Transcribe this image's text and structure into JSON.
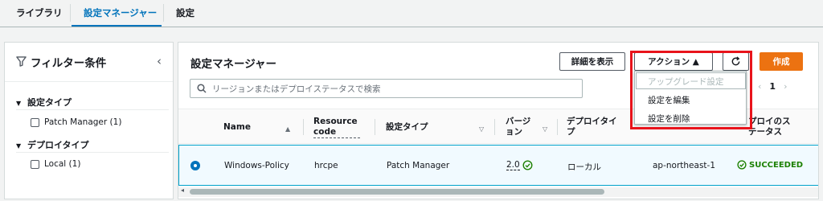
{
  "tabs": [
    {
      "label": "ライブラリ"
    },
    {
      "label": "設定マネージャー"
    },
    {
      "label": "設定"
    }
  ],
  "filter_panel": {
    "title": "フィルター条件",
    "groups": [
      {
        "label": "設定タイプ",
        "options": [
          {
            "label": "Patch Manager (1)"
          }
        ]
      },
      {
        "label": "デプロイタイプ",
        "options": [
          {
            "label": "Local (1)"
          }
        ]
      }
    ]
  },
  "main": {
    "title": "設定マネージャー",
    "details_button": "詳細を表示",
    "actions_button": "アクション ▲",
    "create_button": "作成",
    "search_placeholder": "リージョンまたはデプロイステータスで検索",
    "pager": {
      "current_page": "1"
    },
    "columns": {
      "name": "Name",
      "resource_code_1": "Resource",
      "resource_code_2": "code",
      "type": "設定タイプ",
      "version_1": "バージ",
      "version_2": "ョン",
      "deploy_type_1": "デプロイタイ",
      "deploy_type_2": "プ",
      "status_1": "プロイのス",
      "status_2": "テータス"
    },
    "rows": [
      {
        "name": "Windows-Policy",
        "resource_code": "hrcpe",
        "type": "Patch Manager",
        "version": "2.0",
        "deploy_type": "ローカル",
        "region": "ap-northeast-1",
        "status": "SUCCEEDED"
      }
    ]
  },
  "actions_menu": {
    "items": [
      {
        "label": "アップグレード設定",
        "disabled": true
      },
      {
        "label": "設定を編集",
        "disabled": false
      },
      {
        "label": "設定を削除",
        "disabled": false
      }
    ]
  },
  "colors": {
    "accent": "#0073bb",
    "primary_button": "#ec7211",
    "success": "#1d8102",
    "highlight_box": "#e8131b"
  }
}
